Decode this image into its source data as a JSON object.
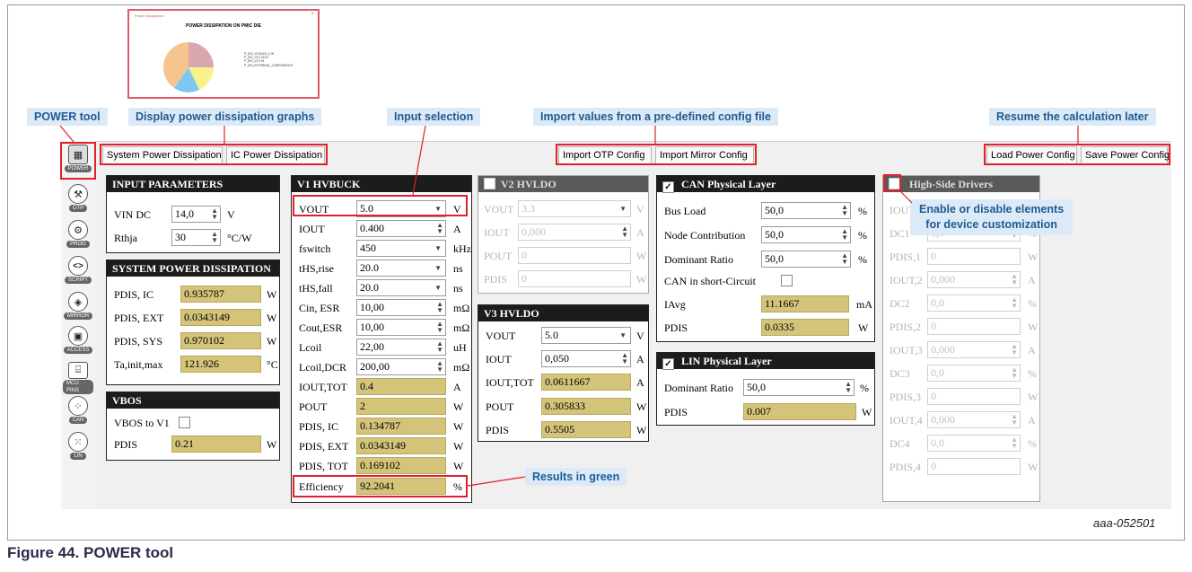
{
  "callouts": {
    "power_tool": "POWER tool",
    "display_graphs": "Display power dissipation graphs",
    "input_selection": "Input selection",
    "import_values": "Import values from a pre-defined config file",
    "resume": "Resume the calculation later",
    "enable_disable_1": "Enable or disable elements",
    "enable_disable_2": "for device customization",
    "results_green": "Results in green"
  },
  "thumbnail": {
    "window_title": "Power Dissipation",
    "heading": "POWER DISSIPATION ON PMIC DIE",
    "legend": [
      "P_DIS_V1 BUCK_0 W",
      "P_DIS_V3 0.28 W",
      "P_DIS_V2 0 W",
      "P_DIS_EXTERNAL_COMPONENTS"
    ],
    "slice_colors": [
      "#d9a7ad",
      "#f7f28a",
      "#7fc6ef",
      "#f6c48e"
    ]
  },
  "sidebar": [
    {
      "icon": "calculator-icon",
      "label": "POWER"
    },
    {
      "icon": "hammer-icon",
      "label": "OTP"
    },
    {
      "icon": "gear-icon",
      "label": "PROG"
    },
    {
      "icon": "script-icon",
      "label": "SCRIPT"
    },
    {
      "icon": "mirror-icon",
      "label": "MIRROR"
    },
    {
      "icon": "chip-icon",
      "label": "ACCESS"
    },
    {
      "icon": "pins-icon",
      "label": "MCU PINS"
    },
    {
      "icon": "can-icon",
      "label": "CAN"
    },
    {
      "icon": "lin-icon",
      "label": "LIN"
    }
  ],
  "toolbar": {
    "system_power": "System Power Dissipation",
    "ic_power": "IC Power Dissipation",
    "import_otp": "Import OTP Config",
    "import_mirror": "Import Mirror Config",
    "load_config": "Load Power Config",
    "save_config": "Save Power Config"
  },
  "input_params": {
    "title": "INPUT PARAMETERS",
    "vin_label": "VIN DC",
    "vin_value": "14,0",
    "vin_unit": "V",
    "rthja_label": "Rthja",
    "rthja_value": "30",
    "rthja_unit": "°C/W"
  },
  "system_power": {
    "title": "SYSTEM POWER DISSIPATION",
    "rows": [
      {
        "label": "PDIS, IC",
        "value": "0.935787",
        "unit": "W"
      },
      {
        "label": "PDIS, EXT",
        "value": "0.0343149",
        "unit": "W"
      },
      {
        "label": "PDIS, SYS",
        "value": "0.970102",
        "unit": "W"
      },
      {
        "label": "Ta,init,max",
        "value": "121.926",
        "unit": "°C"
      }
    ]
  },
  "vbos": {
    "title": "VBOS",
    "vbos_label": "VBOS to V1",
    "pdis_label": "PDIS",
    "pdis_value": "0.21",
    "pdis_unit": "W"
  },
  "v1": {
    "title": "V1 HVBUCK",
    "vout_label": "VOUT",
    "vout_value": "5.0",
    "vout_unit": "V",
    "iout_label": "IOUT",
    "iout_value": "0.400",
    "iout_unit": "A",
    "fsw_label": "fswitch",
    "fsw_value": "450",
    "fsw_unit": "kHz",
    "rise_label": "tHS,rise",
    "rise_value": "20.0",
    "rise_unit": "ns",
    "fall_label": "tHS,fall",
    "fall_value": "20.0",
    "fall_unit": "ns",
    "cin_label": "Cin, ESR",
    "cin_value": "10,00",
    "cin_unit": "mΩ",
    "cout_label": "Cout,ESR",
    "cout_value": "10,00",
    "cout_unit": "mΩ",
    "lcoil_label": "Lcoil",
    "lcoil_value": "22,00",
    "lcoil_unit": "uH",
    "ldcr_label": "Lcoil,DCR",
    "ldcr_value": "200,00",
    "ldcr_unit": "mΩ",
    "iouttot_label": "IOUT,TOT",
    "iouttot_value": "0.4",
    "iouttot_unit": "A",
    "pout_label": "POUT",
    "pout_value": "2",
    "pout_unit": "W",
    "pdisic_label": "PDIS, IC",
    "pdisic_value": "0.134787",
    "pdisic_unit": "W",
    "pdisext_label": "PDIS, EXT",
    "pdisext_value": "0.0343149",
    "pdisext_unit": "W",
    "pdistot_label": "PDIS, TOT",
    "pdistot_value": "0.169102",
    "pdistot_unit": "W",
    "eff_label": "Efficiency",
    "eff_value": "92.2041",
    "eff_unit": "%"
  },
  "v2": {
    "title": "V2 HVLDO",
    "vout_label": "VOUT",
    "vout_value": "3.3",
    "vout_unit": "V",
    "iout_label": "IOUT",
    "iout_value": "0,000",
    "iout_unit": "A",
    "pout_label": "POUT",
    "pout_value": "0",
    "pout_unit": "W",
    "pdis_label": "PDIS",
    "pdis_value": "0",
    "pdis_unit": "W"
  },
  "v3": {
    "title": "V3 HVLDO",
    "vout_label": "VOUT",
    "vout_value": "5.0",
    "vout_unit": "V",
    "iout_label": "IOUT",
    "iout_value": "0,050",
    "iout_unit": "A",
    "iouttot_label": "IOUT,TOT",
    "iouttot_value": "0.0611667",
    "iouttot_unit": "A",
    "pout_label": "POUT",
    "pout_value": "0.305833",
    "pout_unit": "W",
    "pdis_label": "PDIS",
    "pdis_value": "0.5505",
    "pdis_unit": "W"
  },
  "can": {
    "title": "CAN Physical Layer",
    "busload_label": "Bus Load",
    "busload_value": "50,0",
    "busload_unit": "%",
    "node_label": "Node Contribution",
    "node_value": "50,0",
    "node_unit": "%",
    "dom_label": "Dominant Ratio",
    "dom_value": "50,0",
    "dom_unit": "%",
    "short_label": "CAN in short-Circuit",
    "iavg_label": "IAvg",
    "iavg_value": "11.1667",
    "iavg_unit": "mA",
    "pdis_label": "PDIS",
    "pdis_value": "0.0335",
    "pdis_unit": "W"
  },
  "lin": {
    "title": "LIN Physical Layer",
    "dom_label": "Dominant Ratio",
    "dom_value": "50,0",
    "dom_unit": "%",
    "pdis_label": "PDIS",
    "pdis_value": "0.007",
    "pdis_unit": "W"
  },
  "hsd": {
    "title": "High-Side Drivers",
    "rows": [
      {
        "label": "IOUT,1",
        "value": "0,000",
        "unit": "A"
      },
      {
        "label": "DC1",
        "value": "0,0",
        "unit": "%"
      },
      {
        "label": "PDIS,1",
        "value": "0",
        "unit": "W"
      },
      {
        "label": "IOUT,2",
        "value": "0,000",
        "unit": "A"
      },
      {
        "label": "DC2",
        "value": "0,0",
        "unit": "%"
      },
      {
        "label": "PDIS,2",
        "value": "0",
        "unit": "W"
      },
      {
        "label": "IOUT,3",
        "value": "0,000",
        "unit": "A"
      },
      {
        "label": "DC3",
        "value": "0,0",
        "unit": "%"
      },
      {
        "label": "PDIS,3",
        "value": "0",
        "unit": "W"
      },
      {
        "label": "IOUT,4",
        "value": "0,000",
        "unit": "A"
      },
      {
        "label": "DC4",
        "value": "0,0",
        "unit": "%"
      },
      {
        "label": "PDIS,4",
        "value": "0",
        "unit": "W"
      }
    ]
  },
  "figure": {
    "id": "aaa-052501",
    "caption": "Figure 44.  POWER tool"
  }
}
